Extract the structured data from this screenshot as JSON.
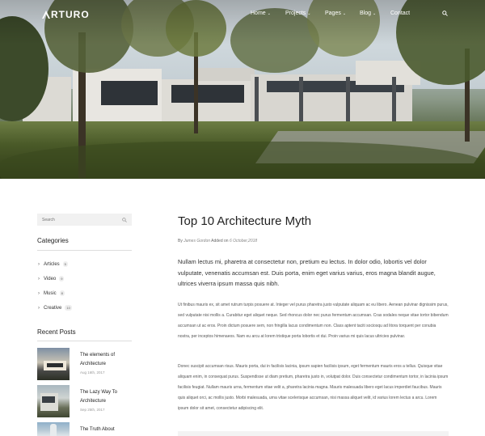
{
  "brand": {
    "logo_text": "RTURO"
  },
  "nav": {
    "items": [
      {
        "label": "Home",
        "dropdown": true
      },
      {
        "label": "Projects",
        "dropdown": true
      },
      {
        "label": "Pages",
        "dropdown": true
      },
      {
        "label": "Blog",
        "dropdown": true
      },
      {
        "label": "Contact",
        "dropdown": false
      }
    ],
    "search_icon": "search-icon"
  },
  "sidebar": {
    "search_placeholder": "Search",
    "categories_title": "Categories",
    "categories": [
      {
        "label": "Articles",
        "count": "5"
      },
      {
        "label": "Video",
        "count": "9"
      },
      {
        "label": "Music",
        "count": "8"
      },
      {
        "label": "Creative",
        "count": "10"
      }
    ],
    "recent_title": "Recent Posts",
    "recent_posts": [
      {
        "title": "The elements of Architecture",
        "date": "Aug 16th, 2017"
      },
      {
        "title": "The Lazy Way To Architecture",
        "date": "Sep 25th, 2017"
      },
      {
        "title": "The Truth About",
        "date": ""
      }
    ]
  },
  "article": {
    "title": "Top 10 Architecture Myth",
    "by_label": "By",
    "author": "James Gordon",
    "added_on": "Added on",
    "date": "6 October,2018",
    "lead": "Nullam lectus mi, pharetra at consectetur non, pretium eu lectus. In dolor odio, lobortis vel dolor vulputate, venenatis accumsan est. Duis porta, enim eget varius varius, eros magna blandit augue, ultrices viverra ipsum massa quis nibh.",
    "p1": "Ut finibus mauris ex, sit amet rutrum turpis posuere at. Integer vel purus pharetra justo vulputate aliquam ac eu libero. Aenean pulvinar dignissim purus, sed vulputate nisi mollis a. Curabitur eget aliquet neque. Sed rhoncus dolor nec purus fermentum accumsan. Cras sodales neque vitae tortor bibendum accumsan ut ac eros. Proin dictum posuere sem, non fringilla lacus condimentum non. Class aptent taciti sociosqu ad litora torquent per conubia nostra, per inceptos himenaeos. Nam eu arcu at lorem tristique porta lobortis et dui. Proin varius mi quis lacus ultricies pulvinar.",
    "p2": "Donec suscipit accumsan risus. Mauris porta, dui in facilisis lacinia, ipsum sapien facilisis ipsum, eget fermentum mauris eros a tellus. Quisque vitae aliquam enim, in consequat purus. Suspendisse ut diam pretium, pharetra justo in, volutpat dolor. Duis consectetur condimentum tortor, in lacinia ipsum facilisis feugiat. Nullam mauris urna, fermentum vitae velit a, pharetra lacinia magna. Mauris malesuada libero eget lacus imperdiet faucibus. Mauris quis aliquet orci, ac mollis justo. Morbi malesuada, urna vitae scelerisque accumsan, nisi massa aliquet velit, id varius lorem lectus a arcu. Lorem ipsum dolor sit amet, consectetur adipiscing elit."
  }
}
